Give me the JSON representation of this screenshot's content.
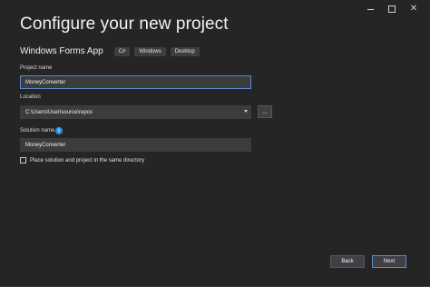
{
  "window": {
    "title": "Configure your new project",
    "controls": {
      "minimize_icon": "minimize-icon",
      "maximize_icon": "maximize-icon",
      "close_icon": "close-icon",
      "close_glyph": "✕"
    }
  },
  "template": {
    "name": "Windows Forms App",
    "tags": [
      "C#",
      "Windows",
      "Desktop"
    ]
  },
  "project_name": {
    "label": "Project name",
    "value": "MoneyConverter"
  },
  "location": {
    "label": "Location",
    "value": "C:\\Users\\User\\source\\repos",
    "browse_label": "..."
  },
  "solution_name": {
    "label": "Solution name",
    "value": "MoneyConverter",
    "info_glyph": "i"
  },
  "same_directory": {
    "label": "Place solution and project in the same directory",
    "checked": false
  },
  "footer": {
    "back_label": "Back",
    "next_label": "Next"
  },
  "colors": {
    "background": "#252526",
    "field": "#3c3c3c",
    "focus_border": "#5b8bd0",
    "tag_bg": "#3e3e42",
    "info_blue": "#2f8ee0"
  }
}
